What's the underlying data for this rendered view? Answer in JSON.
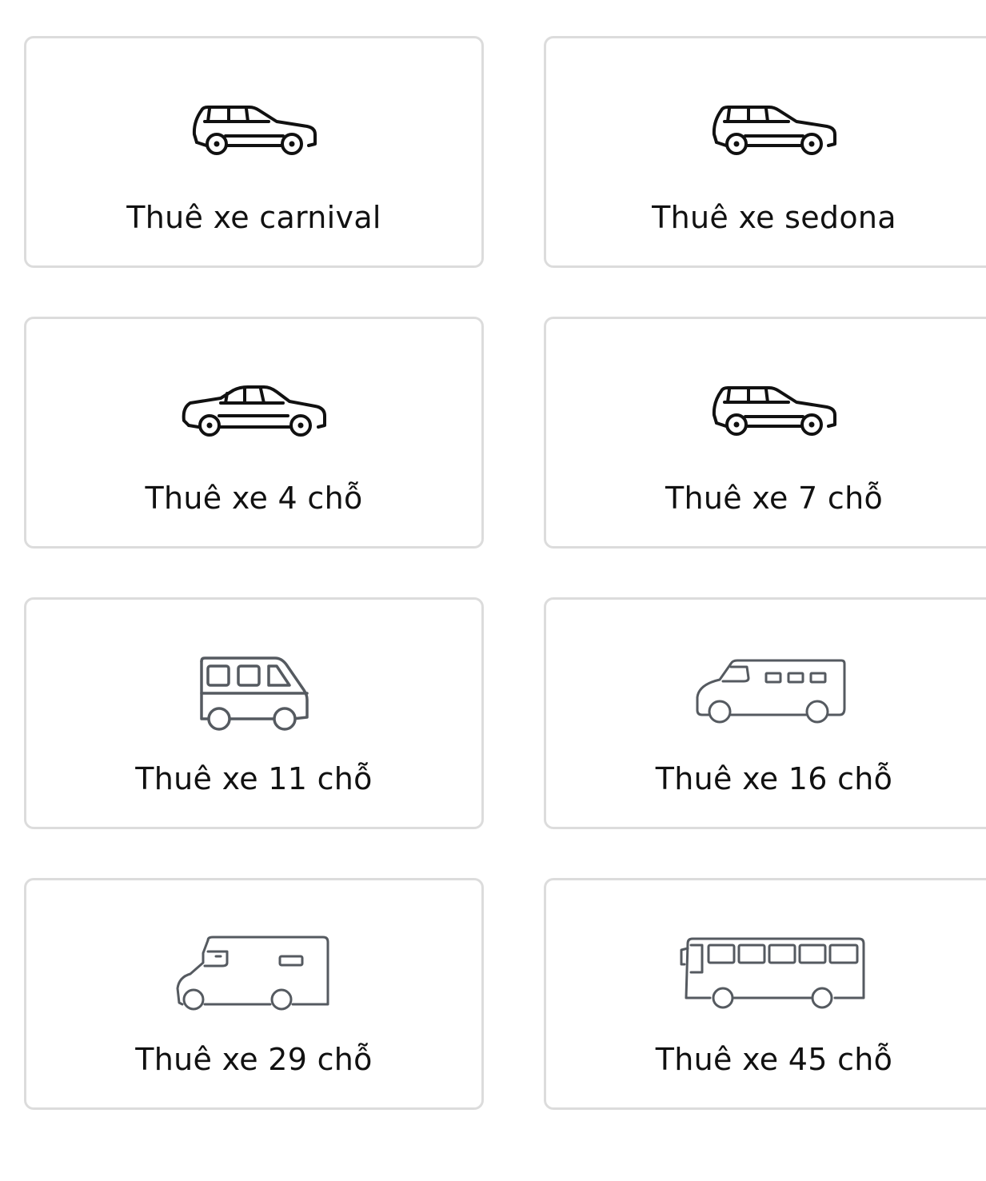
{
  "services": [
    {
      "label": "Thuê xe carnival",
      "icon": "suv-icon"
    },
    {
      "label": "Thuê xe sedona",
      "icon": "suv-icon"
    },
    {
      "label": "Thuê xe 4 chỗ",
      "icon": "sedan-icon"
    },
    {
      "label": "Thuê xe 7 chỗ",
      "icon": "suv-icon"
    },
    {
      "label": "Thuê xe 11 chỗ",
      "icon": "minibus-icon"
    },
    {
      "label": "Thuê xe 16 chỗ",
      "icon": "van-icon"
    },
    {
      "label": "Thuê xe 29 chỗ",
      "icon": "coach-icon"
    },
    {
      "label": "Thuê xe 45 chỗ",
      "icon": "bus-icon"
    }
  ],
  "colors": {
    "border": "#dcdcdc",
    "text": "#111111",
    "icon_dark": "#111111",
    "icon_gray": "#555a60"
  }
}
